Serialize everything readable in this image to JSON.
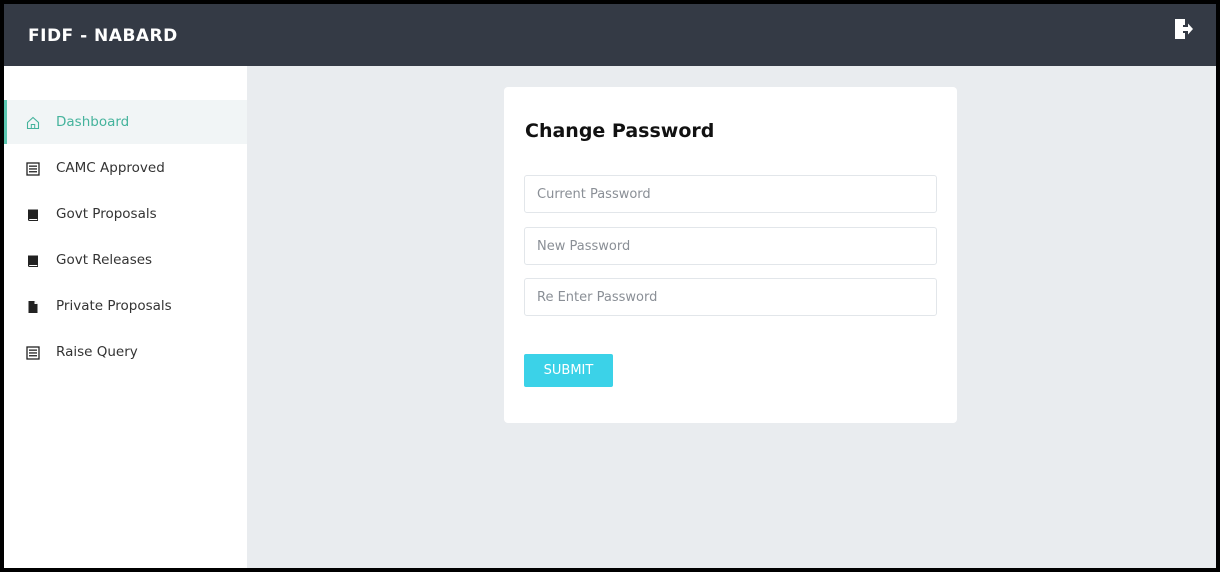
{
  "header": {
    "brand": "FIDF - NABARD",
    "logout_icon": "logout-icon"
  },
  "sidebar": {
    "items": [
      {
        "label": "Dashboard",
        "icon": "home-icon",
        "active": true
      },
      {
        "label": "CAMC Approved",
        "icon": "list-icon"
      },
      {
        "label": "Govt Proposals",
        "icon": "book-icon"
      },
      {
        "label": "Govt Releases",
        "icon": "book-icon"
      },
      {
        "label": "Private Proposals",
        "icon": "file-icon"
      },
      {
        "label": "Raise Query",
        "icon": "list-icon"
      }
    ]
  },
  "form": {
    "title": "Change Password",
    "current_password": {
      "placeholder": "Current Password",
      "value": ""
    },
    "new_password": {
      "placeholder": "New Password",
      "value": ""
    },
    "reenter_password": {
      "placeholder": "Re Enter Password",
      "value": ""
    },
    "submit_label": "SUBMIT"
  },
  "colors": {
    "topbar": "#343a45",
    "accent_active": "#45b39c",
    "submit": "#3bd2e8",
    "background": "#e9ecef"
  }
}
